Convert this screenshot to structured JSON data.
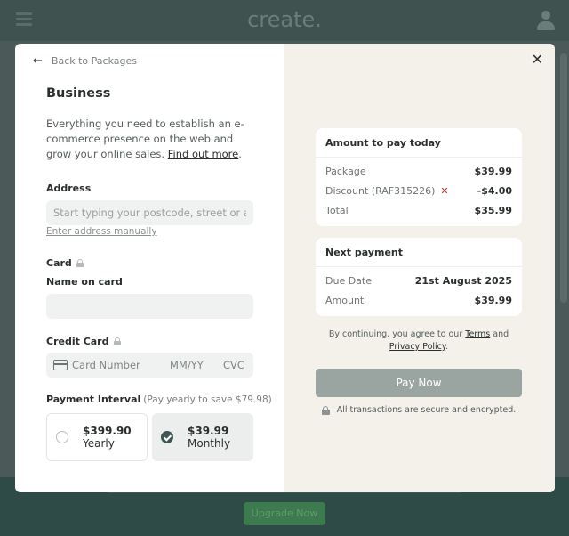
{
  "background": {
    "logo": "create.",
    "upgrade_label": "Upgrade Now"
  },
  "modal": {
    "back_label": "Back to Packages",
    "plan": {
      "title": "Business",
      "description": "Everything you need to establish an e-commerce presence on the web and grow your online sales.",
      "find_out_more": "Find out more"
    },
    "address": {
      "label": "Address",
      "placeholder": "Start typing your postcode, street or address",
      "manual_link": "Enter address manually"
    },
    "card": {
      "label": "Card",
      "name_label": "Name on card",
      "name_value": "",
      "credit_label": "Credit Card",
      "number_placeholder": "Card Number",
      "expiry_placeholder": "MM/YY",
      "cvc_placeholder": "CVC"
    },
    "payment_interval": {
      "label": "Payment Interval",
      "save_note": "(Pay yearly to save $79.98)",
      "options": [
        {
          "price": "$399.90",
          "period": "Yearly",
          "selected": false
        },
        {
          "price": "$39.99",
          "period": "Monthly",
          "selected": true
        }
      ]
    },
    "summary": {
      "today": {
        "title": "Amount to pay today",
        "rows": [
          {
            "label": "Package",
            "value": "$39.99"
          },
          {
            "label": "Discount (RAF315226)",
            "value": "-$4.00"
          },
          {
            "label": "Total",
            "value": "$35.99"
          }
        ],
        "remove_discount_icon": "close-icon"
      },
      "next": {
        "title": "Next payment",
        "rows": [
          {
            "label": "Due Date",
            "value": "21st August 2025"
          },
          {
            "label": "Amount",
            "value": "$39.99"
          }
        ]
      },
      "terms_prefix": "By continuing, you agree to our",
      "terms_link": "Terms",
      "terms_and": "and",
      "privacy_link": "Privacy Policy",
      "terms_suffix": ".",
      "pay_button": "Pay Now",
      "secure_text": "All transactions are secure and encrypted."
    },
    "close_symbol": "✕",
    "back_arrow": "←"
  },
  "colors": {
    "primary": "#3e5654",
    "pay_button": "#9aa4a0",
    "right_panel": "#f4f1ea",
    "discount_remove": "#c0392b"
  }
}
